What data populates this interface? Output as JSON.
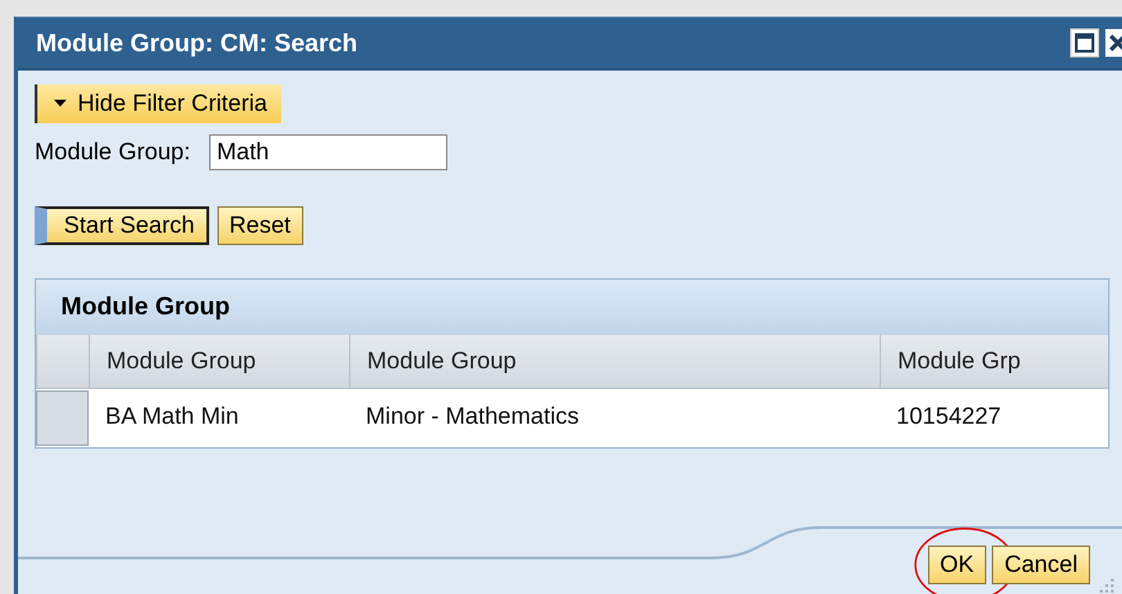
{
  "window": {
    "title": "Module Group: CM: Search"
  },
  "filter_toggle": {
    "label": "Hide Filter Criteria",
    "expanded": true
  },
  "fields": [
    {
      "label": "Module Group:",
      "value": "Math"
    }
  ],
  "search_buttons": [
    {
      "label": "Start Search",
      "kind": "primary"
    },
    {
      "label": "Reset",
      "kind": "plain"
    }
  ],
  "table": {
    "title": "Module Group",
    "columns": [
      "Module Group",
      "Module Group",
      "Module Grp"
    ],
    "rows": [
      {
        "selected": false,
        "cells": [
          "BA Math Min",
          "Minor - Mathematics",
          "10154227"
        ]
      }
    ]
  },
  "footer_buttons": [
    {
      "label": "OK",
      "highlighted": true
    },
    {
      "label": "Cancel",
      "highlighted": false
    }
  ]
}
